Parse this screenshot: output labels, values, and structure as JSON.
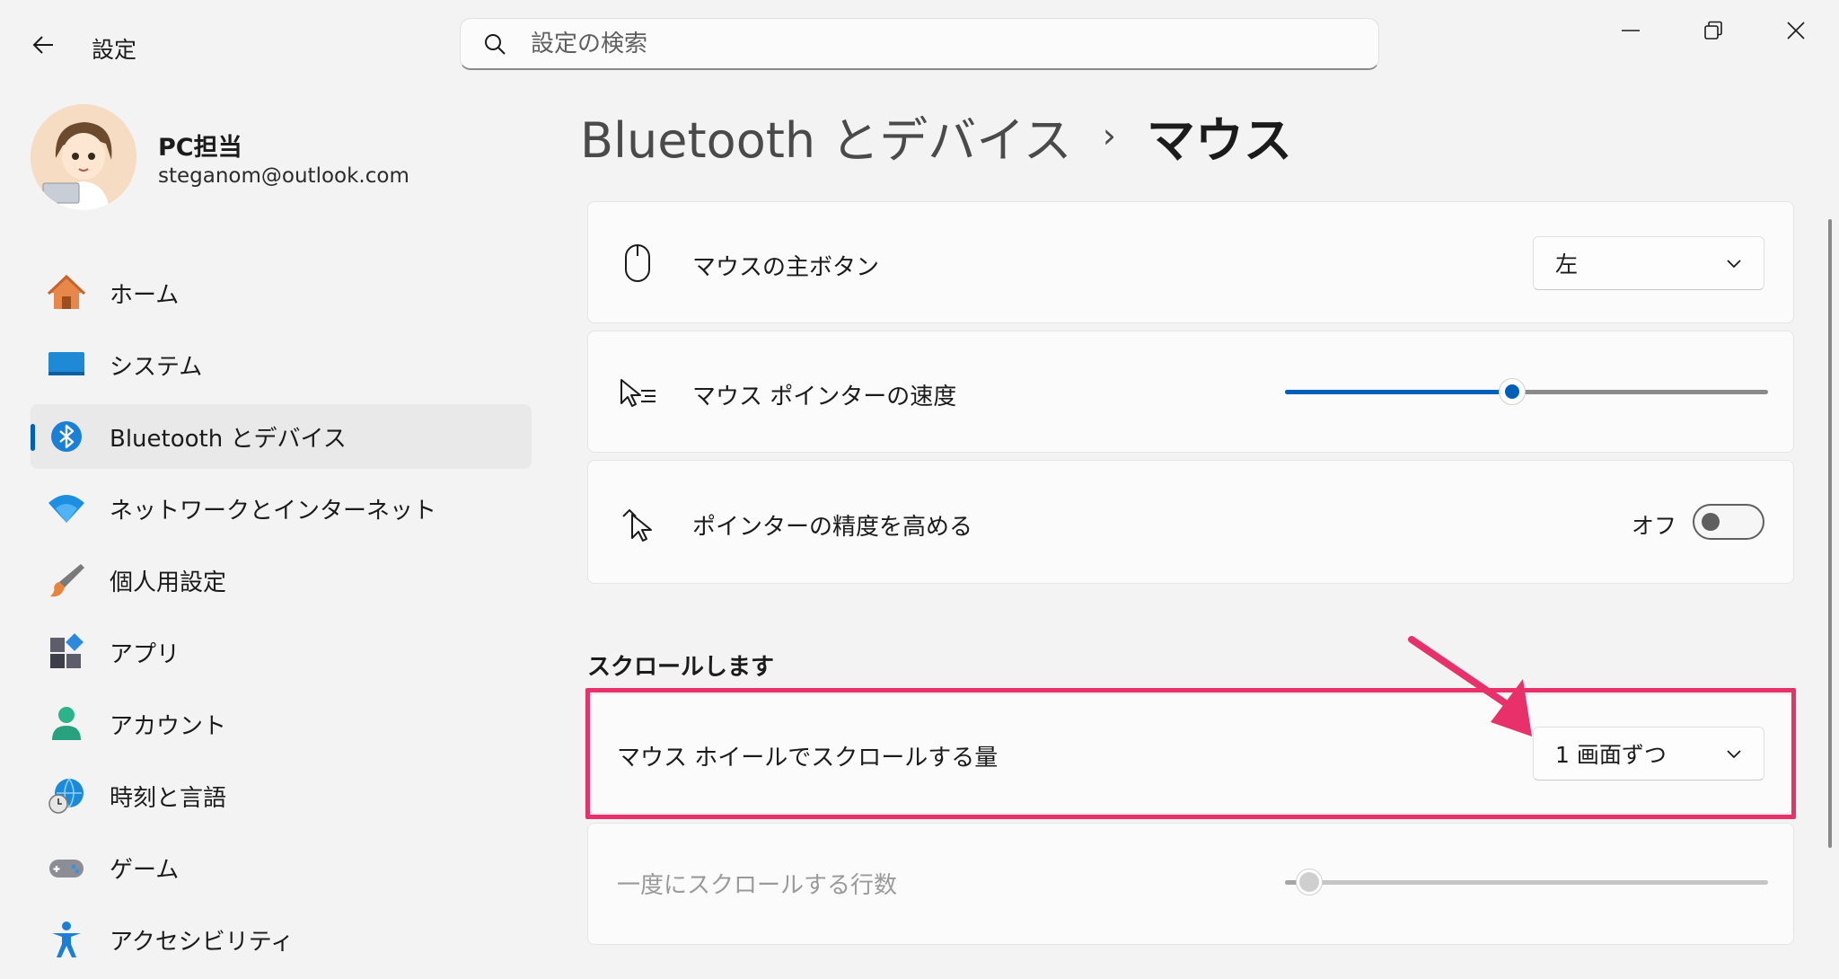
{
  "app": {
    "title": "設定",
    "search_placeholder": "設定の検索"
  },
  "user": {
    "name": "PC担当",
    "email": "steganom@outlook.com"
  },
  "nav": {
    "items": [
      {
        "label": "ホーム",
        "icon": "home-icon"
      },
      {
        "label": "システム",
        "icon": "system-icon"
      },
      {
        "label": "Bluetooth とデバイス",
        "icon": "bluetooth-icon",
        "active": true
      },
      {
        "label": "ネットワークとインターネット",
        "icon": "wifi-icon"
      },
      {
        "label": "個人用設定",
        "icon": "brush-icon"
      },
      {
        "label": "アプリ",
        "icon": "apps-icon"
      },
      {
        "label": "アカウント",
        "icon": "account-icon"
      },
      {
        "label": "時刻と言語",
        "icon": "time-language-icon"
      },
      {
        "label": "ゲーム",
        "icon": "gamepad-icon"
      },
      {
        "label": "アクセシビリティ",
        "icon": "accessibility-icon"
      }
    ]
  },
  "header": {
    "parent": "Bluetooth とデバイス",
    "separator": "›",
    "current": "マウス"
  },
  "settings": {
    "primary_button": {
      "label": "マウスの主ボタン",
      "value": "左"
    },
    "pointer_speed": {
      "label": "マウス ポインターの速度",
      "value_fraction": 0.47
    },
    "pointer_precision": {
      "label": "ポインターの精度を高める",
      "state": "オフ"
    },
    "scroll_section_title": "スクロールします",
    "scroll_amount": {
      "label": "マウス ホイールでスクロールする量",
      "value": "1 画面ずつ"
    },
    "scroll_lines": {
      "label": "一度にスクロールする行数",
      "value_fraction": 0.05,
      "disabled": true
    }
  },
  "colors": {
    "accent": "#005fb8",
    "highlight": "#e8306a"
  }
}
